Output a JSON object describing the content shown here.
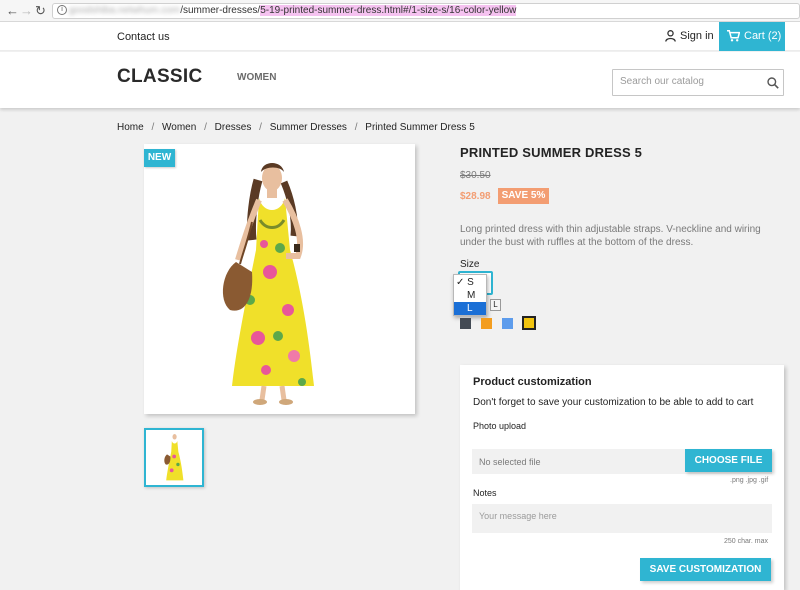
{
  "browser": {
    "url_blurred": "goodshiba.netwhum.com",
    "url_path": "/summer-dresses/",
    "url_highlight": "5-19-printed-summer-dress.html#/1-size-s/16-color-yellow"
  },
  "topbar": {
    "contact": "Contact us",
    "signin": "Sign in",
    "cart": "Cart (2)"
  },
  "header": {
    "logo": "CLASSIC",
    "nav_women": "WOMEN",
    "search_placeholder": "Search our catalog"
  },
  "breadcrumb": [
    "Home",
    "Women",
    "Dresses",
    "Summer Dresses",
    "Printed Summer Dress 5"
  ],
  "breadcrumb_sep": "/",
  "product": {
    "badge": "NEW",
    "title": "PRINTED SUMMER DRESS 5",
    "old_price": "$30.50",
    "price": "$28.98",
    "discount": "SAVE 5%",
    "description": "Long printed dress with thin adjustable straps. V-neckline and wiring under the bust with ruffles at the bottom of the dress.",
    "size_label": "Size",
    "size_options": [
      "S",
      "M",
      "L"
    ],
    "size_selected": "S",
    "size_highlighted": "L",
    "size_tooltip": "L",
    "colors": [
      "#434a54",
      "#f39d1f",
      "#5d9cec",
      "#f1c40f"
    ]
  },
  "customization": {
    "title": "Product customization",
    "subtitle": "Don't forget to save your customization to be able to add to cart",
    "photo_label": "Photo upload",
    "file_status": "No selected file",
    "choose_button": "CHOOSE FILE",
    "file_types": ".png .jpg .gif",
    "notes_label": "Notes",
    "notes_placeholder": "Your message here",
    "char_limit": "250 char. max",
    "save_button": "SAVE CUSTOMIZATION"
  },
  "colors": {
    "accent": "#2fb5d2",
    "price": "#f39d72",
    "discount_bg": "#f39d72",
    "highlight": "#f5c2f0"
  }
}
